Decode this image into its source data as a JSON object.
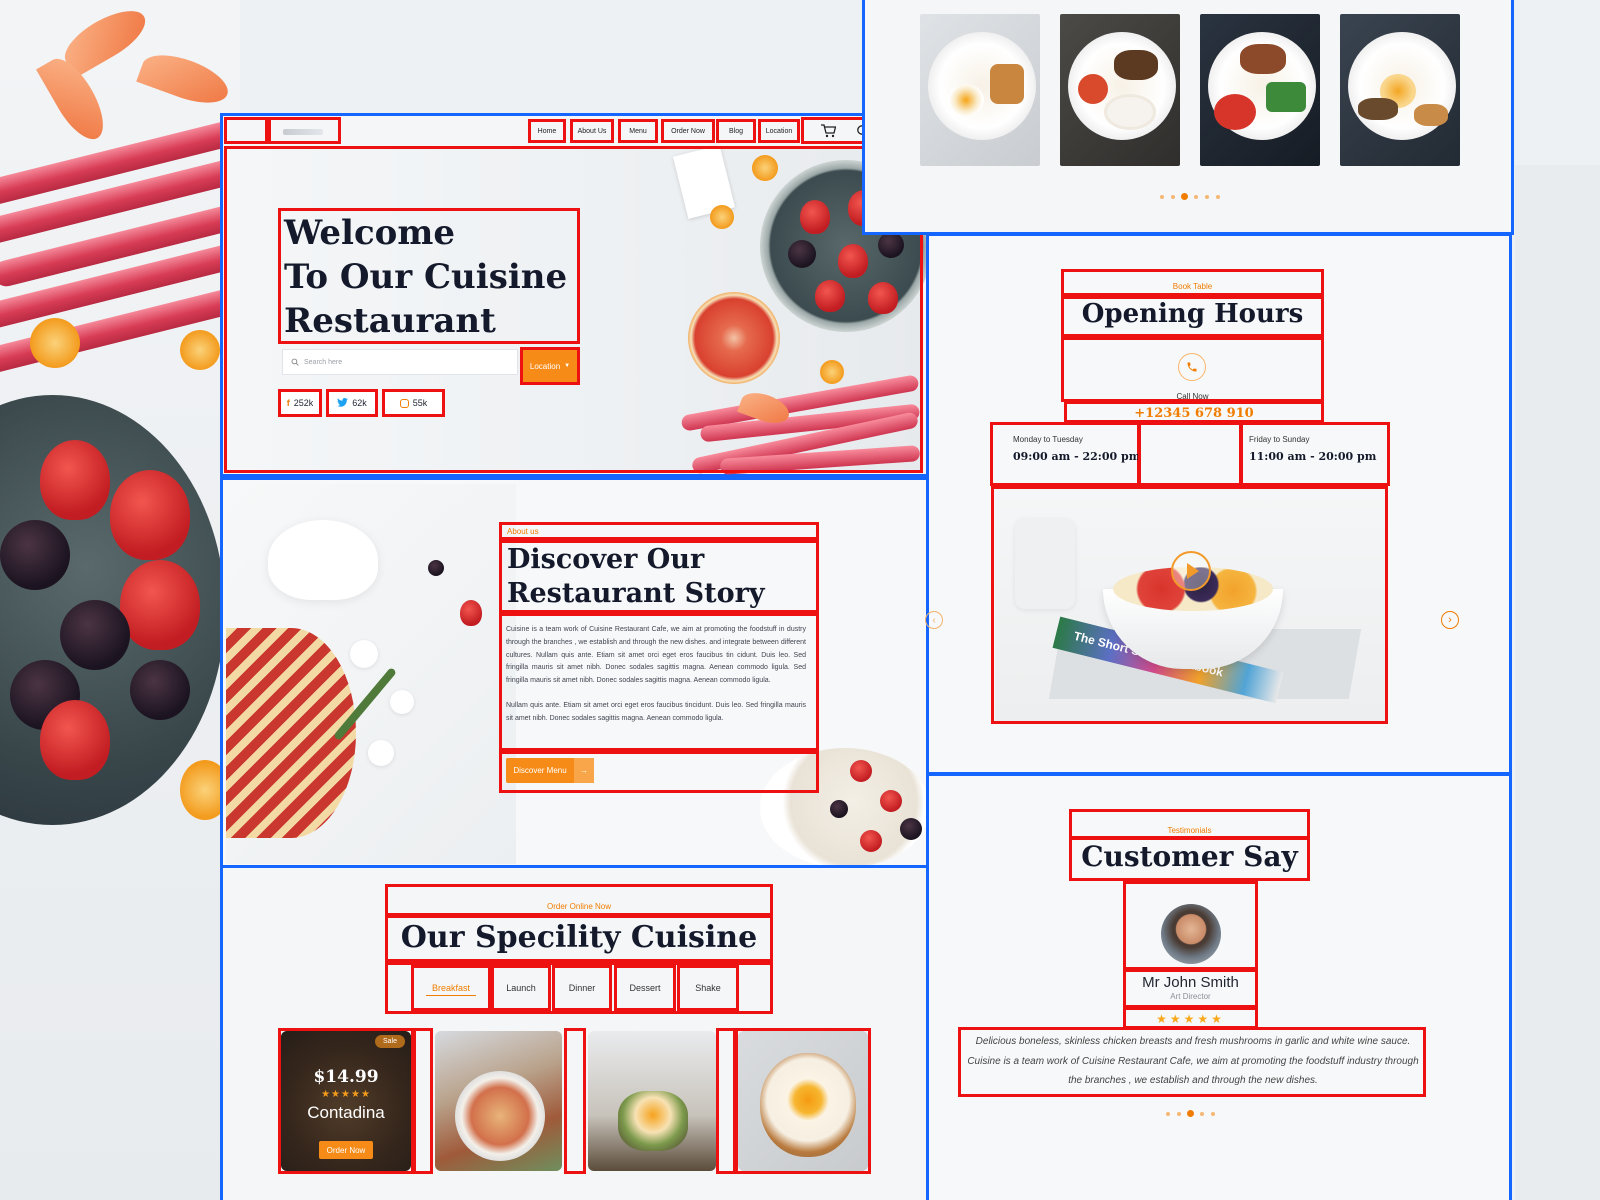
{
  "nav": {
    "items": [
      "Home",
      "About Us",
      "Menu",
      "Order Now",
      "Blog",
      "Location"
    ]
  },
  "hero": {
    "title_line1": "Welcome",
    "title_line2": "To Our Cuisine",
    "title_line3": "Restaurant",
    "search_placeholder": "Search here",
    "location_label": "Location",
    "social": {
      "facebook": "252k",
      "twitter": "62k",
      "instagram": "55k"
    }
  },
  "about": {
    "kicker": "About us",
    "title_line1": "Discover Our",
    "title_line2": "Restaurant Story",
    "para1": "Cuisine is a team work of Cuisine Restaurant Cafe, we aim at promoting the foodstuff in dustry through the branches , we establish and through the new dishes. and integrate between different cultures. Nullam quis ante. Etiam sit amet orci eget eros faucibus tin cidunt. Duis leo. Sed fringilla mauris sit amet nibh. Donec sodales sagittis magna. Aenean commodo ligula. Sed fringilla mauris sit amet nibh. Donec sodales sagittis magna. Aenean commodo ligula.",
    "para2": "Nullam quis ante. Etiam sit amet orci eget eros faucibus tincidunt. Duis leo. Sed fringilla mauris sit amet nibh. Donec sodales sagittis magna. Aenean commodo ligula.",
    "button": "Discover Menu",
    "button_arrow": "→"
  },
  "cuisine": {
    "kicker": "Order Online Now",
    "title": "Our Specility Cuisine",
    "tabs": [
      "Breakfast",
      "Launch",
      "Dinner",
      "Dessert",
      "Shake"
    ],
    "active_tab": 0,
    "featured": {
      "badge": "Sale",
      "price": "$14.99",
      "rating": "★★★★★",
      "name": "Contadina",
      "button": "Order Now"
    }
  },
  "gallery": {
    "dots": 6,
    "active_dot": 2
  },
  "hours": {
    "kicker": "Book Table",
    "title": "Opening Hours",
    "call_label": "Call Now",
    "phone": "+12345 678 910",
    "left_days": "Monday to Tuesday",
    "left_time": "09:00 am - 22:00 pm",
    "right_days": "Friday to Sunday",
    "right_time": "11:00 am - 20:00 pm",
    "book_spine": "The Short Stack Cookbook"
  },
  "testimonial": {
    "kicker": "Testimonials",
    "title": "Customer Say",
    "name": "Mr John Smith",
    "role": "Art Director",
    "rating": "★★★★★",
    "quote": "Delicious boneless, skinless chicken breasts and fresh mushrooms in garlic and white wine sauce. Cuisine is a team work of Cuisine Restaurant Cafe, we aim at promoting the foodstuff industry through the branches , we establish and through the new dishes.",
    "active_dot": 2
  },
  "colors": {
    "accent": "#f07d00",
    "outline_red": "#ee1111",
    "panel_blue": "#1565ff",
    "heading": "#141a2b"
  }
}
